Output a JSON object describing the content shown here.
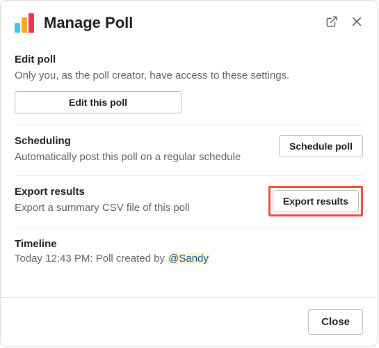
{
  "header": {
    "title": "Manage Poll"
  },
  "edit": {
    "title": "Edit poll",
    "desc": "Only you, as the poll creator, have access to these settings.",
    "button": "Edit this poll"
  },
  "scheduling": {
    "title": "Scheduling",
    "desc": "Automatically post this poll on a regular schedule",
    "button": "Schedule poll"
  },
  "export": {
    "title": "Export results",
    "desc": "Export a summary CSV file of this poll",
    "button": "Export results"
  },
  "timeline": {
    "title": "Timeline",
    "prefix": "Today 12:43 PM: Poll created by ",
    "mention": "@Sandy"
  },
  "footer": {
    "close": "Close"
  }
}
